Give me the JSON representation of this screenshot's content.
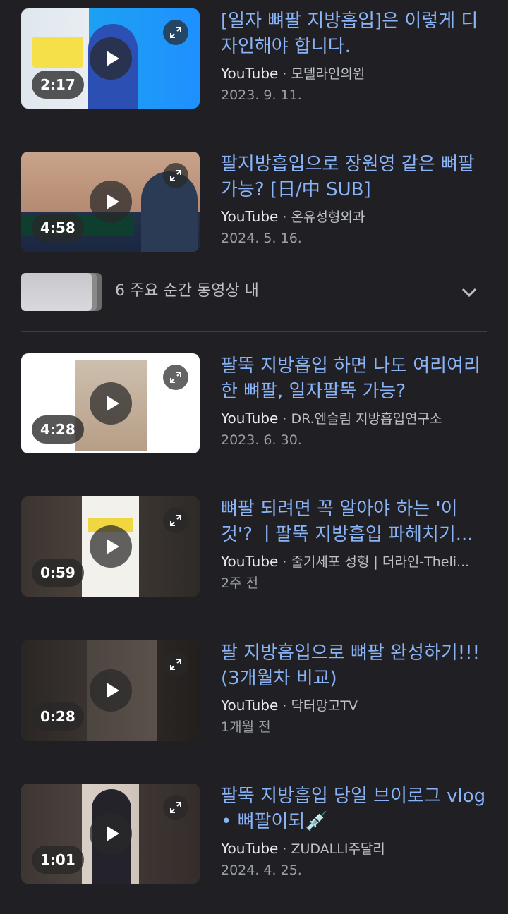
{
  "results": [
    {
      "title": "[일자 뼈팔 지방흡입]은 이렇게 디자인해야 합니다.",
      "source": "YouTube",
      "channel": "모델라인의원",
      "date": "2023. 9. 11.",
      "duration": "2:17"
    },
    {
      "title": "팔지방흡입으로 장원영 같은 뼈팔 가능? [日/中 SUB]",
      "source": "YouTube",
      "channel": "온유성형외과",
      "date": "2024. 5. 16.",
      "duration": "4:58"
    },
    {
      "title": "팔뚝 지방흡입 하면 나도 여리여리한 뼈팔, 일자팔뚝 가능?",
      "source": "YouTube",
      "channel": "DR.엔슬림 지방흡입연구소",
      "date": "2023. 6. 30.",
      "duration": "4:28"
    },
    {
      "title": "뼈팔 되려면 꼭 알아야 하는 '이것'? ㅣ팔뚝 지방흡입 파헤치기...",
      "source": "YouTube",
      "channel": "줄기세포 성형 | 더라인-Theli...",
      "date": "2주 전",
      "duration": "0:59"
    },
    {
      "title": "팔 지방흡입으로 뼈팔 완성하기!!! (3개월차 비교)",
      "source": "YouTube",
      "channel": "닥터망고TV",
      "date": "1개월 전",
      "duration": "0:28"
    },
    {
      "title": "팔뚝 지방흡입 당일 브이로그 vlog • 뼈팔이되💉",
      "source": "YouTube",
      "channel": "ZUDALLI주달리",
      "date": "2024. 4. 25.",
      "duration": "1:01"
    }
  ],
  "key_moments": {
    "label": "6 주요 순간 동영상 내"
  },
  "meta_separator": " · ",
  "icons": {
    "play": "play-icon",
    "expand": "expand-icon",
    "chevron": "chevron-down-icon"
  }
}
